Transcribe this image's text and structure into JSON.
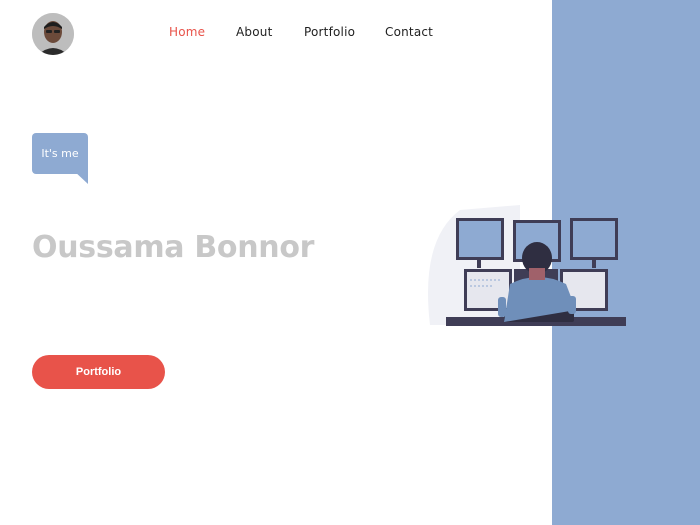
{
  "nav": {
    "items": [
      {
        "label": "Home",
        "active": true
      },
      {
        "label": "About",
        "active": false
      },
      {
        "label": "Portfolio",
        "active": false
      },
      {
        "label": "Contact",
        "active": false
      }
    ]
  },
  "hero": {
    "bubble_text": "It's me",
    "name": "Oussama Bonnor",
    "cta_label": "Portfolio"
  },
  "colors": {
    "accent": "#e8534a",
    "panel": "#8eaad2",
    "name_text": "#c8c8c8"
  },
  "icons": {
    "avatar": "profile-avatar",
    "illustration": "developer-monitors-illustration"
  }
}
